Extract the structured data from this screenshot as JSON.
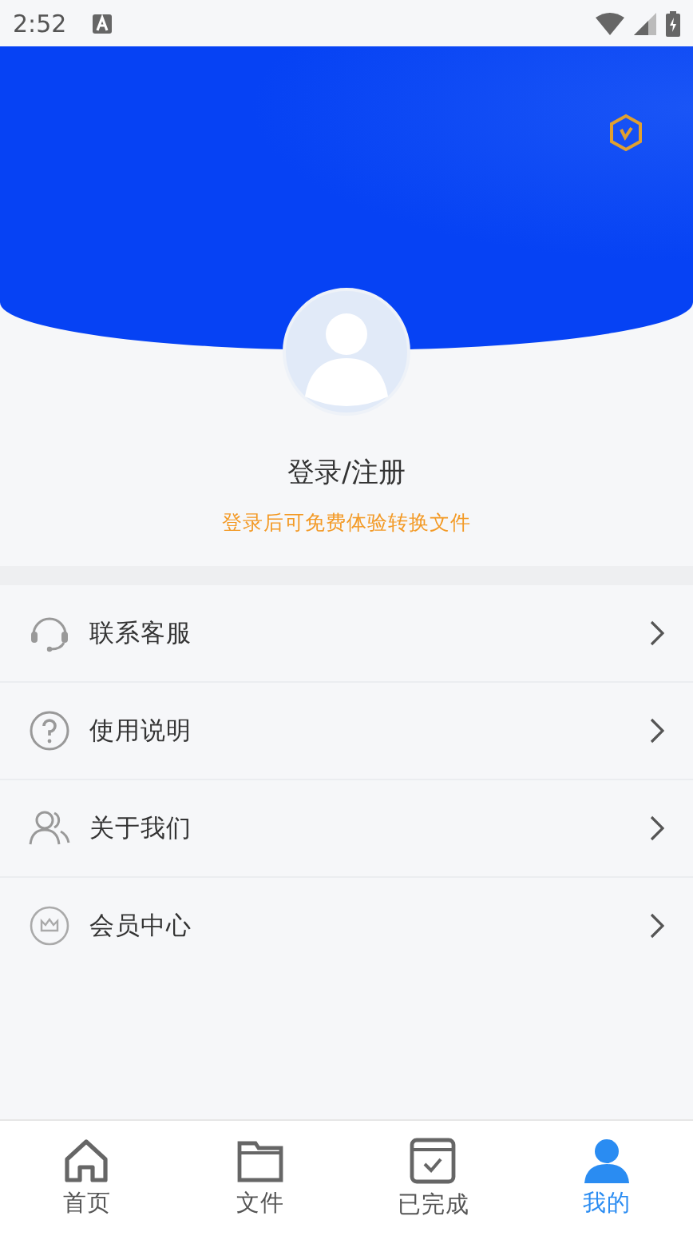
{
  "status_bar": {
    "time": "2:52"
  },
  "profile": {
    "login_label": "登录/注册",
    "hint": "登录后可免费体验转换文件"
  },
  "menu": [
    {
      "kind": "headset",
      "label": "联系客服"
    },
    {
      "kind": "help",
      "label": "使用说明"
    },
    {
      "kind": "people",
      "label": "关于我们"
    },
    {
      "kind": "crown",
      "label": "会员中心"
    }
  ],
  "tabs": [
    {
      "kind": "home",
      "label": "首页",
      "selected": false
    },
    {
      "kind": "folder",
      "label": "文件",
      "selected": false
    },
    {
      "kind": "done",
      "label": "已完成",
      "selected": false
    },
    {
      "kind": "user",
      "label": "我的",
      "selected": true
    }
  ]
}
